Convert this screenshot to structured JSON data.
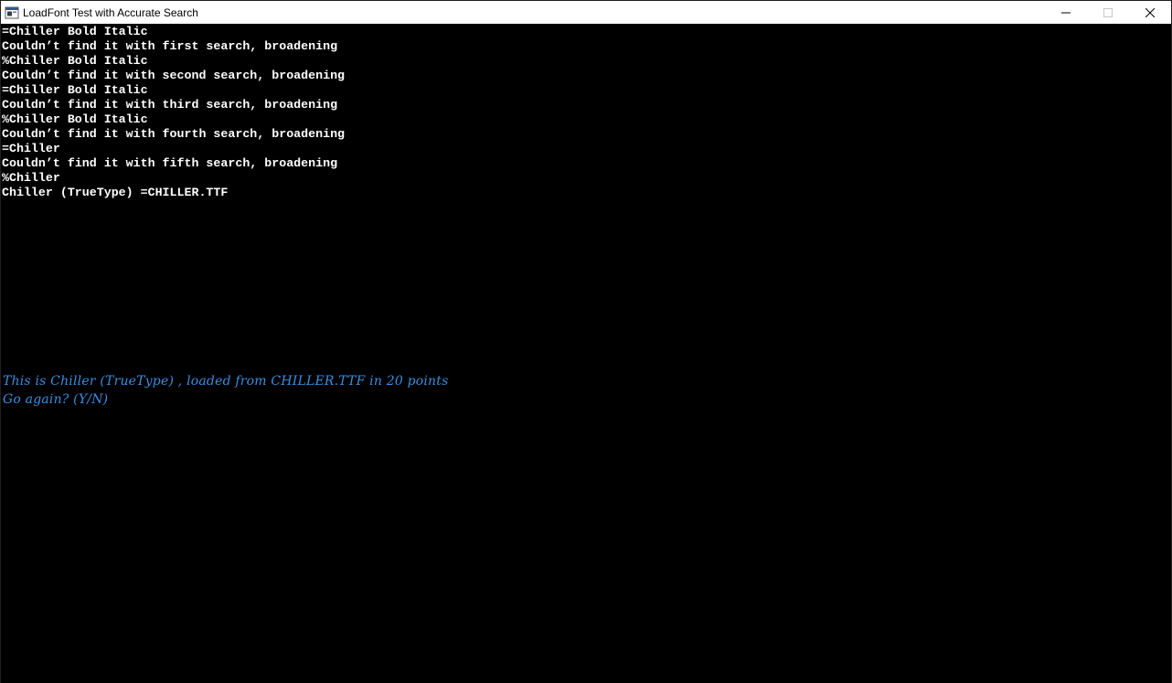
{
  "window": {
    "title": "LoadFont Test with Accurate Search",
    "icon": "console-window-icon",
    "controls": [
      "minimize-icon",
      "maximize-icon",
      "close-icon"
    ]
  },
  "console": {
    "background": "#000000",
    "text_color": "#ffffff",
    "lines": [
      "=Chiller Bold Italic",
      "Couldn’t find it with first search, broadening",
      "%Chiller Bold Italic",
      "Couldn’t find it with second search, broadening",
      "=Chiller Bold Italic",
      "Couldn’t find it with third search, broadening",
      "%Chiller Bold Italic",
      "Couldn’t find it with fourth search, broadening",
      "=Chiller",
      "Couldn’t find it with fifth search, broadening",
      "%Chiller",
      "Chiller (TrueType) =CHILLER.TTF"
    ],
    "font_sample_color": "#3a8ee0",
    "font_sample_lines": [
      "This is Chiller (TrueType) , loaded from CHILLER.TTF in 20 points",
      "Go again? (Y/N)"
    ]
  }
}
